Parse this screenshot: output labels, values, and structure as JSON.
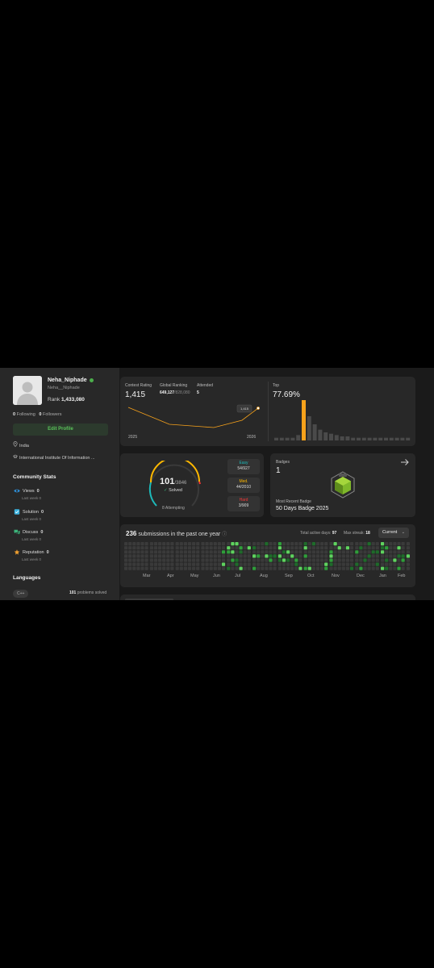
{
  "profile": {
    "name": "Neha_Niphade",
    "handle": "Neha__Niphade",
    "rank_label": "Rank",
    "rank_value": "1,433,080",
    "following_count": "0",
    "following_label": "Following",
    "followers_count": "0",
    "followers_label": "Followers",
    "edit_label": "Edit Profile",
    "country": "India",
    "institute": "International Institute Of Information ..."
  },
  "community": {
    "title": "Community Stats",
    "items": [
      {
        "label": "Views",
        "value": "0",
        "sub": "Last week",
        "sub_value": "0",
        "icon": "eye-icon",
        "color": "#2f8fd8"
      },
      {
        "label": "Solution",
        "value": "0",
        "sub": "Last week",
        "sub_value": "0",
        "icon": "solution-icon",
        "color": "#3bb3e0"
      },
      {
        "label": "Discuss",
        "value": "0",
        "sub": "Last week",
        "sub_value": "0",
        "icon": "discuss-icon",
        "color": "#3bb37a"
      },
      {
        "label": "Reputation",
        "value": "0",
        "sub": "Last week",
        "sub_value": "0",
        "icon": "reputation-icon",
        "color": "#f0a030"
      }
    ]
  },
  "languages": {
    "title": "Languages",
    "tag": "C++",
    "count": "101",
    "count_label": "problems solved"
  },
  "contest": {
    "rating_label": "Contest Rating",
    "rating": "1,415",
    "global_label": "Global Ranking",
    "global_value": "649,127",
    "global_total": "/828,080",
    "attended_label": "Attended",
    "attended": "5",
    "tooltip": "1,415",
    "x_start": "2025",
    "x_end": "2026",
    "top_label": "Top",
    "top_value": "77.69%"
  },
  "chart_data": {
    "type": "bar",
    "title": "Top",
    "series": [
      {
        "values": [
          2,
          2,
          2,
          2,
          4,
          30,
          18,
          12,
          8,
          6,
          5,
          4,
          3,
          3,
          2,
          2,
          2,
          2,
          2,
          2,
          2,
          2,
          2,
          2,
          2
        ]
      }
    ],
    "highlight_index": 5,
    "highlight_color": "#f7a21b",
    "bar_color": "#4a4a4a"
  },
  "solved": {
    "count": "101",
    "total": "/3846",
    "label": "Solved",
    "attempting": "8 Attempting",
    "easy_label": "Easy",
    "easy_value": "54/927",
    "med_label": "Med.",
    "med_value": "44/2010",
    "hard_label": "Hard",
    "hard_value": "3/909",
    "easy_color": "#1cbaba",
    "med_color": "#ffb800",
    "hard_color": "#f63737"
  },
  "badges": {
    "label": "Badges",
    "count": "1",
    "recent_label": "Most Recent Badge",
    "recent_name": "50 Days Badge 2025"
  },
  "submissions": {
    "count": "236",
    "label": "submissions in the past one year",
    "active_label": "Total active days:",
    "active_value": "97",
    "streak_label": "Max streak:",
    "streak_value": "18",
    "dropdown": "Current",
    "months": [
      "Mar",
      "Apr",
      "May",
      "Jun",
      "Jul",
      "Aug",
      "Sep",
      "Oct",
      "Nov",
      "Dec",
      "Jan",
      "Feb"
    ]
  }
}
